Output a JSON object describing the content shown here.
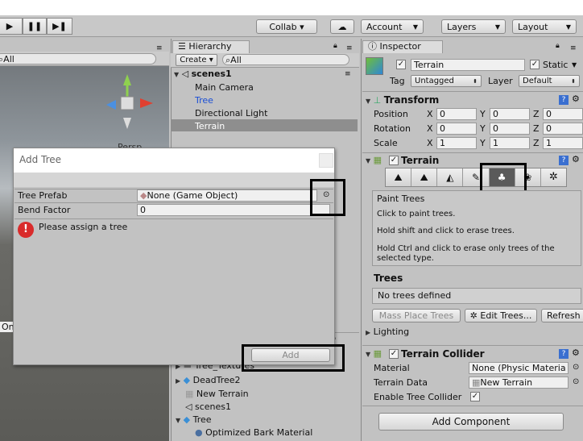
{
  "toolbar": {
    "collab": "Collab ▾",
    "account": "Account",
    "layers": "Layers",
    "layout": "Layout"
  },
  "hierarchy": {
    "tab": "Hierarchy",
    "create": "Create ▾",
    "search": "All",
    "scene": "scenes1",
    "items": [
      "Main Camera",
      "Tree",
      "Directional Light",
      "Terrain"
    ]
  },
  "scene_view": {
    "search": "All",
    "persp": "Persp",
    "on_label": "On P"
  },
  "project": {
    "items": [
      "Tree_Textures",
      "DeadTree2",
      "New Terrain",
      "scenes1",
      "Tree",
      "Optimized Bark Material"
    ]
  },
  "dialog": {
    "title": "Add Tree",
    "tree_prefab_label": "Tree Prefab",
    "tree_prefab_value": "None (Game Object)",
    "bend_factor_label": "Bend Factor",
    "bend_factor_value": "0",
    "error": "Please assign a tree",
    "add": "Add"
  },
  "inspector": {
    "tab": "Inspector",
    "object_name": "Terrain",
    "static": "Static",
    "tag_label": "Tag",
    "tag_value": "Untagged",
    "layer_label": "Layer",
    "layer_value": "Default",
    "transform": {
      "title": "Transform",
      "position": "Position",
      "rotation": "Rotation",
      "scale": "Scale",
      "x": "X",
      "y": "Y",
      "z": "Z",
      "pos": [
        "0",
        "0",
        "0"
      ],
      "rot": [
        "0",
        "0",
        "0"
      ],
      "scl": [
        "1",
        "1",
        "1"
      ]
    },
    "terrain": {
      "title": "Terrain",
      "paint_title": "Paint Trees",
      "line1": "Click to paint trees.",
      "line2": "Hold shift and click to erase trees.",
      "line3": "Hold Ctrl and click to erase only trees of the selected type.",
      "trees_header": "Trees",
      "no_trees": "No trees defined",
      "mass_place": "Mass Place Trees",
      "edit_trees": "Edit Trees...",
      "refresh": "Refresh",
      "lighting": "Lighting"
    },
    "collider": {
      "title": "Terrain Collider",
      "material_label": "Material",
      "material_value": "None (Physic Materia",
      "data_label": "Terrain Data",
      "data_value": "New Terrain",
      "enable_label": "Enable Tree Collider"
    },
    "add_component": "Add Component"
  }
}
